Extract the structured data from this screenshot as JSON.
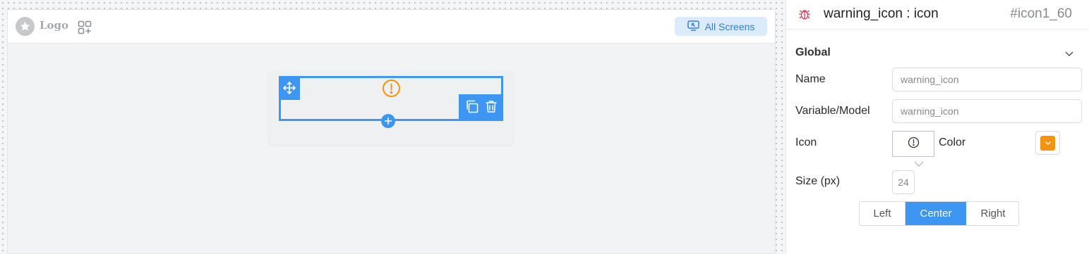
{
  "canvas": {
    "logo_text": "Logo",
    "all_screens_label": "All Screens",
    "selected_element": {
      "icon": "warning-icon",
      "accent_color": "#3d97f2",
      "icon_color": "#f6930e"
    }
  },
  "panel": {
    "title": "warning_icon : icon",
    "id": "#icon1_60",
    "section_title": "Global",
    "fields": {
      "name_label": "Name",
      "name_value": "warning_icon",
      "variable_label": "Variable/Model",
      "variable_value": "warning_icon",
      "icon_label": "Icon",
      "color_label": "Color",
      "color_value": "#f6930e",
      "size_label": "Size (px)",
      "size_value": "24"
    },
    "alignment": {
      "options": [
        "Left",
        "Center",
        "Right"
      ],
      "selected": "Center"
    }
  }
}
